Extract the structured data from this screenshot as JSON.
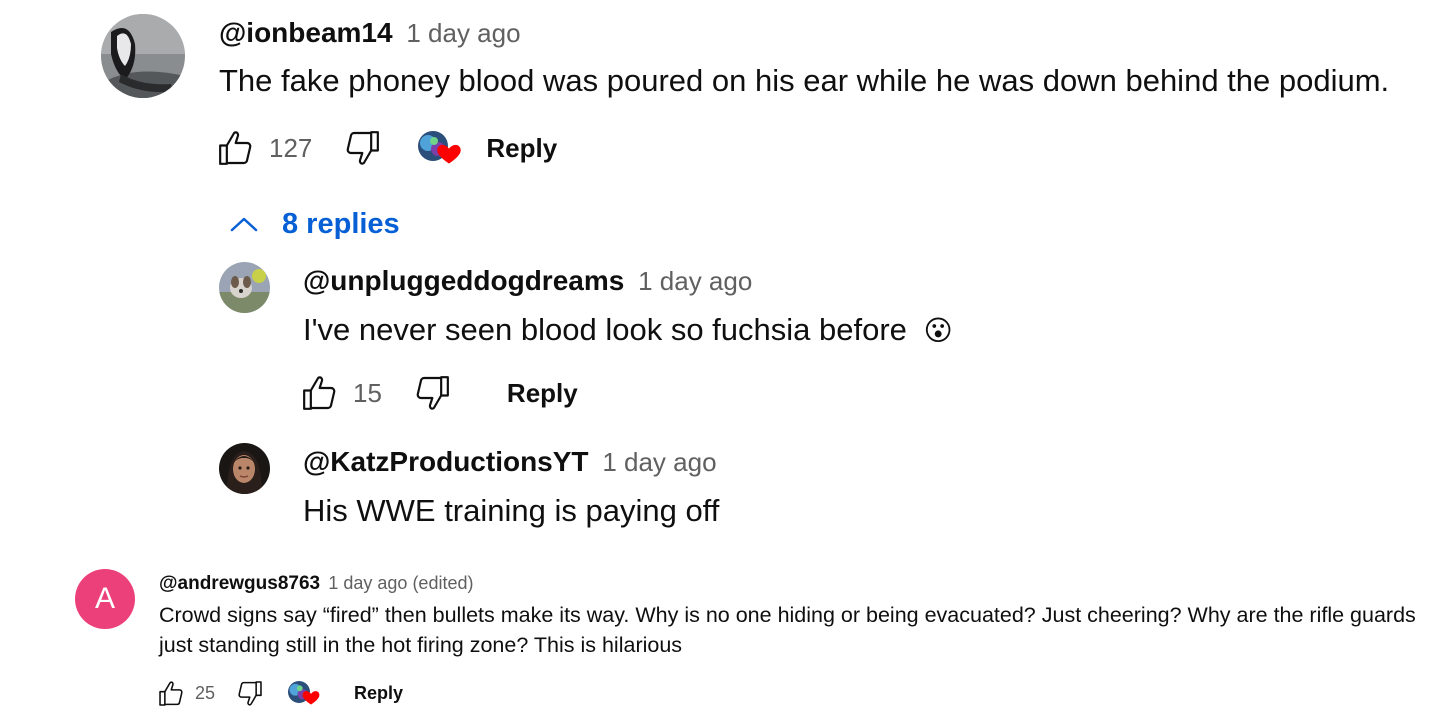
{
  "colors": {
    "text": "#0f0f0f",
    "muted": "#606060",
    "link": "#065fd4",
    "heart": "#ff0000",
    "avatar_pink": "#ec407a"
  },
  "comments": [
    {
      "author": "@ionbeam14",
      "time": "1 day ago",
      "text": "The fake phoney blood was poured on his ear while he was down behind the podium.",
      "likes": "127",
      "reply_label": "Reply",
      "hearted": true,
      "replies_label": "8 replies",
      "replies": [
        {
          "author": "@unpluggeddogdreams",
          "time": "1 day ago",
          "text": "I've never seen blood look so fuchsia before",
          "emoji": "😮",
          "likes": "15",
          "reply_label": "Reply"
        },
        {
          "author": "@KatzProductionsYT",
          "time": "1 day ago",
          "text": "His WWE training is paying off"
        }
      ]
    },
    {
      "author": "@andrewgus8763",
      "time": "1 day ago (edited)",
      "avatar_letter": "A",
      "text": "Crowd signs say “fired” then bullets make its way. Why is no one hiding or being evacuated? Just cheering? Why are the rifle guards just standing still in the hot firing zone? This is hilarious",
      "likes": "25",
      "reply_label": "Reply",
      "hearted": true
    }
  ]
}
